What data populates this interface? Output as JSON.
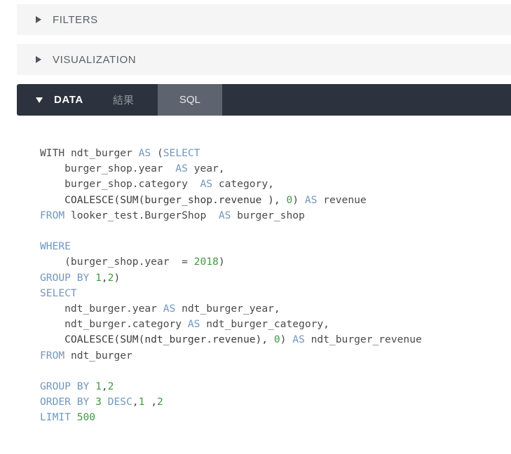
{
  "sections": {
    "filters": {
      "label": "FILTERS",
      "caret": "caret-right-icon",
      "expanded": false
    },
    "visualization": {
      "label": "VISUALIZATION",
      "caret": "caret-right-icon",
      "expanded": false
    },
    "data": {
      "label": "DATA",
      "caret": "caret-down-icon",
      "expanded": true,
      "tabs": [
        {
          "id": "results",
          "label": "結果",
          "active": false
        },
        {
          "id": "sql",
          "label": "SQL",
          "active": true
        }
      ]
    }
  },
  "colors": {
    "section_bar_bg": "#f5f5f5",
    "section_label": "#5a5f66",
    "data_bar_bg": "#2c323e",
    "active_tab_bg": "#5d636f",
    "inactive_tab_text": "#8d919b",
    "sql_keyword": "#7196bf",
    "sql_number": "#3f9b3f",
    "sql_plain": "#4a4a4a"
  },
  "sql": {
    "lines": [
      [
        {
          "t": "WITH ",
          "c": "pl"
        },
        {
          "t": "ndt_burger ",
          "c": "pl"
        },
        {
          "t": "AS",
          "c": "kw"
        },
        {
          "t": " (",
          "c": "pl"
        },
        {
          "t": "SELECT",
          "c": "kw"
        }
      ],
      [
        {
          "t": "    burger_shop.year  ",
          "c": "pl"
        },
        {
          "t": "AS",
          "c": "kw"
        },
        {
          "t": " year,",
          "c": "pl"
        }
      ],
      [
        {
          "t": "    burger_shop.category  ",
          "c": "pl"
        },
        {
          "t": "AS",
          "c": "kw"
        },
        {
          "t": " category,",
          "c": "pl"
        }
      ],
      [
        {
          "t": "    COALESCE(SUM(burger_shop.revenue ), ",
          "c": "fn"
        },
        {
          "t": "0",
          "c": "num"
        },
        {
          "t": ") ",
          "c": "pl"
        },
        {
          "t": "AS",
          "c": "kw"
        },
        {
          "t": " revenue",
          "c": "pl"
        }
      ],
      [
        {
          "t": "FROM",
          "c": "kw"
        },
        {
          "t": " looker_test.BurgerShop  ",
          "c": "pl"
        },
        {
          "t": "AS",
          "c": "kw"
        },
        {
          "t": " burger_shop",
          "c": "pl"
        }
      ],
      [],
      [
        {
          "t": "WHERE",
          "c": "kw"
        }
      ],
      [
        {
          "t": "    (burger_shop.year  = ",
          "c": "pl"
        },
        {
          "t": "2018",
          "c": "num"
        },
        {
          "t": ")",
          "c": "pl"
        }
      ],
      [
        {
          "t": "GROUP BY ",
          "c": "kw"
        },
        {
          "t": "1",
          "c": "num"
        },
        {
          "t": ",",
          "c": "pl"
        },
        {
          "t": "2",
          "c": "num"
        },
        {
          "t": ")",
          "c": "pl"
        }
      ],
      [
        {
          "t": "SELECT",
          "c": "kw"
        }
      ],
      [
        {
          "t": "    ndt_burger.year ",
          "c": "pl"
        },
        {
          "t": "AS",
          "c": "kw"
        },
        {
          "t": " ndt_burger_year,",
          "c": "pl"
        }
      ],
      [
        {
          "t": "    ndt_burger.category ",
          "c": "pl"
        },
        {
          "t": "AS",
          "c": "kw"
        },
        {
          "t": " ndt_burger_category,",
          "c": "pl"
        }
      ],
      [
        {
          "t": "    COALESCE(SUM(ndt_burger.revenue), ",
          "c": "fn"
        },
        {
          "t": "0",
          "c": "num"
        },
        {
          "t": ") ",
          "c": "pl"
        },
        {
          "t": "AS",
          "c": "kw"
        },
        {
          "t": " ndt_burger_revenue",
          "c": "pl"
        }
      ],
      [
        {
          "t": "FROM",
          "c": "kw"
        },
        {
          "t": " ndt_burger",
          "c": "pl"
        }
      ],
      [],
      [
        {
          "t": "GROUP BY ",
          "c": "kw"
        },
        {
          "t": "1",
          "c": "num"
        },
        {
          "t": ",",
          "c": "pl"
        },
        {
          "t": "2",
          "c": "num"
        }
      ],
      [
        {
          "t": "ORDER BY ",
          "c": "kw"
        },
        {
          "t": "3",
          "c": "num"
        },
        {
          "t": " DESC",
          "c": "kw"
        },
        {
          "t": ",",
          "c": "pl"
        },
        {
          "t": "1",
          "c": "num"
        },
        {
          "t": " ,",
          "c": "pl"
        },
        {
          "t": "2",
          "c": "num"
        }
      ],
      [
        {
          "t": "LIMIT ",
          "c": "kw"
        },
        {
          "t": "500",
          "c": "num"
        }
      ]
    ]
  }
}
